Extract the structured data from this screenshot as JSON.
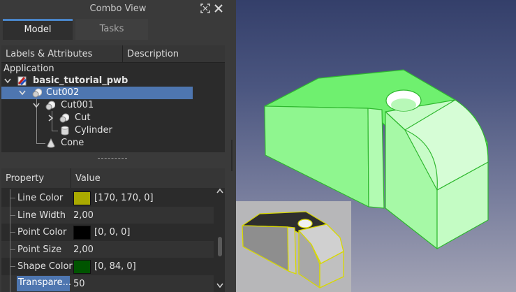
{
  "window": {
    "title": "Combo View"
  },
  "tabs": [
    {
      "label": "Model",
      "active": true
    },
    {
      "label": "Tasks",
      "active": false
    }
  ],
  "tree": {
    "headers": {
      "labels": "Labels & Attributes",
      "description": "Description"
    },
    "root_label": "Application",
    "items": [
      {
        "label": "basic_tutorial_pwb",
        "bold": true,
        "icon": "document-icon"
      },
      {
        "label": "Cut002",
        "selected": true,
        "icon": "cut-icon"
      },
      {
        "label": "Cut001",
        "icon": "cut-icon"
      },
      {
        "label": "Cut",
        "icon": "cut-icon"
      },
      {
        "label": "Cylinder",
        "icon": "cylinder-icon"
      },
      {
        "label": "Cone",
        "icon": "cone-icon"
      }
    ]
  },
  "properties": {
    "headers": {
      "property": "Property",
      "value": "Value"
    },
    "rows": [
      {
        "name": "Line Color",
        "value": "[170, 170, 0]",
        "swatch": "#aaaa00"
      },
      {
        "name": "Line Width",
        "value": "2,00"
      },
      {
        "name": "Point Color",
        "value": "[0, 0, 0]",
        "swatch": "#000000"
      },
      {
        "name": "Point Size",
        "value": "2,00"
      },
      {
        "name": "Shape Color",
        "value": "[0, 84, 0]",
        "swatch": "#005400"
      },
      {
        "name": "Transpare...",
        "value": "50",
        "selected": true
      }
    ]
  },
  "colors": {
    "accent": "#4a85c8",
    "selection": "#4e76b0",
    "model_face": "#80f080",
    "model_edge": "#3cc83c",
    "preview_edge": "#d8d800"
  },
  "icons": {
    "float": "float-window-icon",
    "close": "close-icon",
    "expand": "chevron-down-icon",
    "collapse": "chevron-right-icon",
    "scroll_up": "scroll-up-icon",
    "scroll_down": "scroll-down-icon"
  }
}
